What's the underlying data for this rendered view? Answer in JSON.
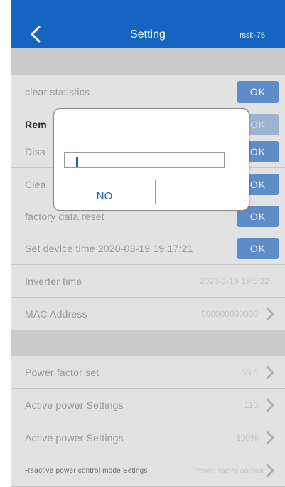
{
  "header": {
    "title": "Setting",
    "rssi": "rssi:-75",
    "back_icon": "chevron-left-icon"
  },
  "rows": {
    "clear_statistics": {
      "label": "clear statistics",
      "button": "OK"
    },
    "remote": {
      "label": "Rem",
      "button": "OK"
    },
    "disable": {
      "label": "Disa",
      "button": "OK"
    },
    "clear": {
      "label": "Clea",
      "button": "OK"
    },
    "factory_reset": {
      "label": "factory data reset",
      "button": "OK"
    },
    "set_device_time": {
      "label": "Set device time 2020-03-19 19:17:21",
      "button": "OK"
    },
    "inverter_time": {
      "label": "Inverter time",
      "value": "2020-3-19 19:5:22"
    },
    "mac_address": {
      "label": "MAC Address",
      "value": "000000000000"
    },
    "power_factor": {
      "label": "Power factor set",
      "value": "55.5"
    },
    "active_power_1": {
      "label": "Active power Settings",
      "value": "110"
    },
    "active_power_2": {
      "label": "Active power Settings",
      "value": "100%"
    },
    "reactive_mode": {
      "label": "Reactive power control mode Setings",
      "value": "Power factor control"
    }
  },
  "dialog": {
    "input_value": "",
    "no_label": "NO"
  },
  "colors": {
    "header": "#1565c0",
    "ok_button": "#5d8fd0",
    "accent": "#1565c0"
  }
}
